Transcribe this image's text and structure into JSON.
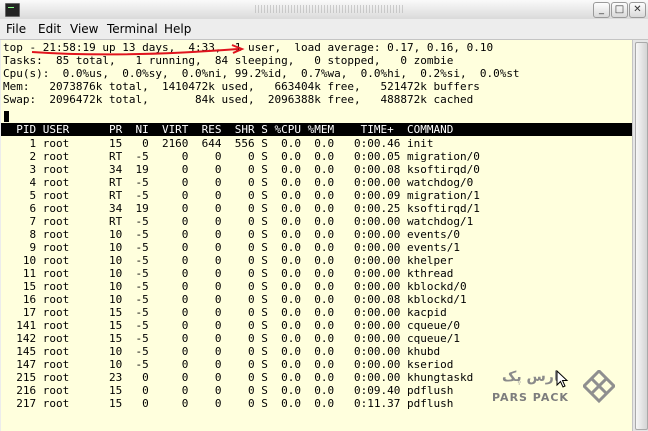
{
  "window": {
    "controls": {
      "minimize": "_",
      "maximize": "□",
      "close": "✕"
    }
  },
  "menu": [
    "File",
    "Edit",
    "View",
    "Terminal",
    "Help"
  ],
  "summary": [
    "top - 21:58:19 up 13 days,  4:33,  1 user,  load average: 0.17, 0.16, 0.10",
    "Tasks:  85 total,   1 running,  84 sleeping,   0 stopped,   0 zombie",
    "Cpu(s):  0.0%us,  0.0%sy,  0.0%ni, 99.2%id,  0.7%wa,  0.0%hi,  0.2%si,  0.0%st",
    "Mem:   2073876k total,  1410472k used,   663404k free,   521472k buffers",
    "Swap:  2096472k total,       84k used,  2096388k free,   488872k cached"
  ],
  "table_header": "  PID USER      PR  NI  VIRT  RES  SHR S %CPU %MEM    TIME+  COMMAND",
  "processes": [
    "    1 root      15   0  2160  644  556 S  0.0  0.0   0:00.46 init",
    "    2 root      RT  -5     0    0    0 S  0.0  0.0   0:00.05 migration/0",
    "    3 root      34  19     0    0    0 S  0.0  0.0   0:00.08 ksoftirqd/0",
    "    4 root      RT  -5     0    0    0 S  0.0  0.0   0:00.00 watchdog/0",
    "    5 root      RT  -5     0    0    0 S  0.0  0.0   0:00.09 migration/1",
    "    6 root      34  19     0    0    0 S  0.0  0.0   0:00.25 ksoftirqd/1",
    "    7 root      RT  -5     0    0    0 S  0.0  0.0   0:00.00 watchdog/1",
    "    8 root      10  -5     0    0    0 S  0.0  0.0   0:00.00 events/0",
    "    9 root      10  -5     0    0    0 S  0.0  0.0   0:00.00 events/1",
    "   10 root      10  -5     0    0    0 S  0.0  0.0   0:00.00 khelper",
    "   11 root      10  -5     0    0    0 S  0.0  0.0   0:00.00 kthread",
    "   15 root      10  -5     0    0    0 S  0.0  0.0   0:00.00 kblockd/0",
    "   16 root      10  -5     0    0    0 S  0.0  0.0   0:00.08 kblockd/1",
    "   17 root      15  -5     0    0    0 S  0.0  0.0   0:00.00 kacpid",
    "  141 root      15  -5     0    0    0 S  0.0  0.0   0:00.00 cqueue/0",
    "  142 root      15  -5     0    0    0 S  0.0  0.0   0:00.00 cqueue/1",
    "  145 root      10  -5     0    0    0 S  0.0  0.0   0:00.00 khubd",
    "  147 root      10  -5     0    0    0 S  0.0  0.0   0:00.00 kseriod",
    "  215 root      23   0     0    0    0 S  0.0  0.0   0:00.00 khungtaskd",
    "  216 root      15   0     0    0    0 S  0.0  0.0   0:09.40 pdflush",
    "  217 root      15   0     0    0    0 S  0.0  0.0   0:11.37 pdflush"
  ],
  "watermark": {
    "brand_latin": "PARS PACK",
    "brand_persian": "پارس پک"
  },
  "colors": {
    "terminal_bg": "#ffffdd",
    "annotation": "#e0141e",
    "header_bg": "#000000"
  }
}
